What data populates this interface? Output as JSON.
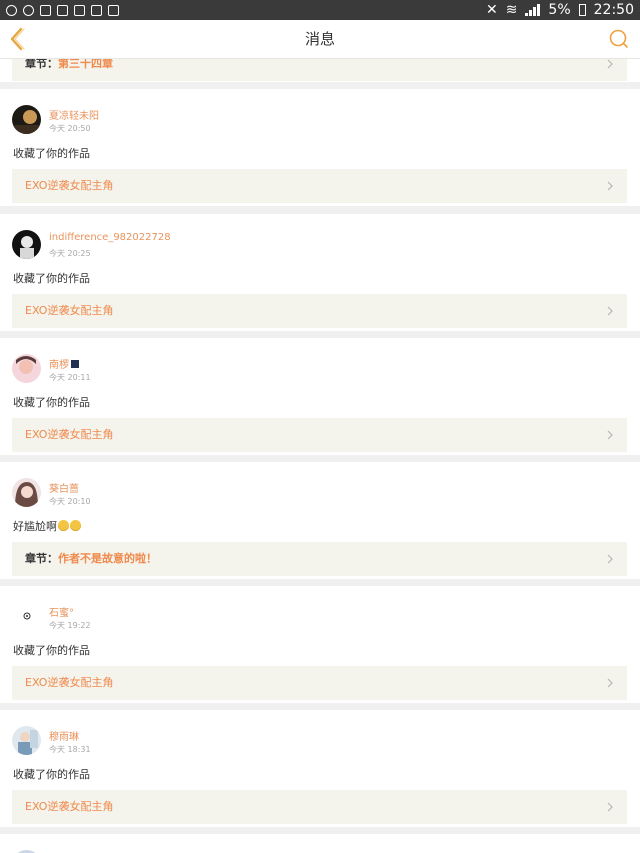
{
  "status_bar": {
    "battery": "5%",
    "time": "22:50"
  },
  "header": {
    "title": "消息",
    "back_icon": "back-chevron-icon",
    "search_icon": "search-icon"
  },
  "accent_color": "#f08a4c",
  "partial_card": {
    "link_prefix": "章节：",
    "link_text": "第三十四章"
  },
  "messages": [
    {
      "username": "夏凉轻未阳",
      "time": "今天 20:50",
      "content": "收藏了你的作品",
      "link_prefix": "",
      "link_text": "EXO逆袭女配主角"
    },
    {
      "username": "indifference_982022728",
      "time": "今天 20:25",
      "content": "收藏了你的作品",
      "link_prefix": "",
      "link_text": "EXO逆袭女配主角"
    },
    {
      "username": "南椤",
      "time": "今天 20:11",
      "content": "收藏了你的作品",
      "link_prefix": "",
      "link_text": "EXO逆袭女配主角"
    },
    {
      "username": "葵白蔷",
      "time": "今天 20:10",
      "content": "好尴尬啊",
      "link_prefix": "章节：",
      "link_text": "作者不是故意的啦！"
    },
    {
      "username": "石蜜°",
      "time": "今天 19:22",
      "content": "收藏了你的作品",
      "link_prefix": "",
      "link_text": "EXO逆袭女配主角"
    },
    {
      "username": "穆雨琳",
      "time": "今天 18:31",
      "content": "收藏了你的作品",
      "link_prefix": "",
      "link_text": "EXO逆袭女配主角"
    }
  ]
}
